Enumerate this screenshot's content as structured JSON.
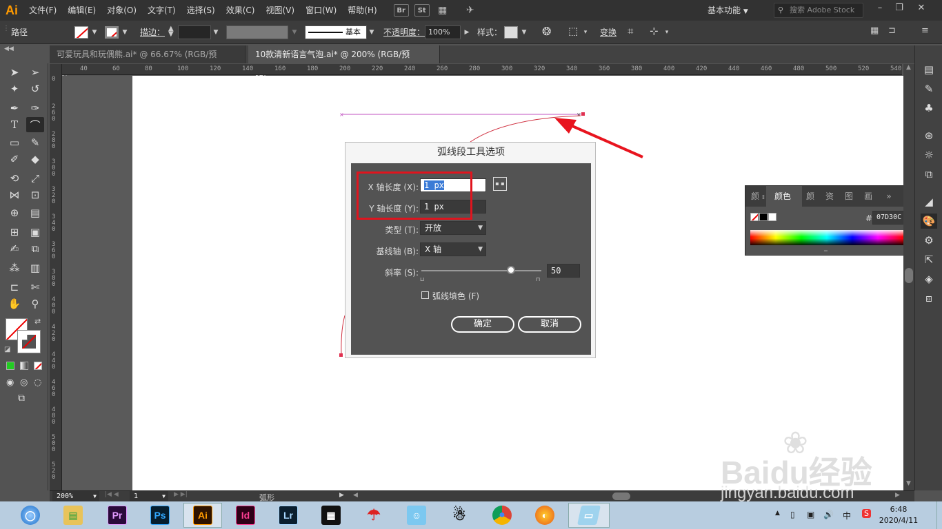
{
  "menubar": {
    "logo": "Ai",
    "items": [
      "文件(F)",
      "编辑(E)",
      "对象(O)",
      "文字(T)",
      "选择(S)",
      "效果(C)",
      "视图(V)",
      "窗口(W)",
      "帮助(H)"
    ],
    "bridge_label": "Br",
    "stock_label": "St",
    "workspace": "基本功能",
    "search_placeholder": "搜索 Adobe Stock",
    "accent_color": "#ff9a00"
  },
  "controlbar": {
    "selection_type": "路径",
    "stroke_label": "描边：",
    "stroke_profile": "基本",
    "opacity_label": "不透明度：",
    "opacity_value": "100%",
    "style_label": "样式：",
    "transform_label": "变换"
  },
  "tabs": [
    {
      "label": "可爱玩具和玩偶熊.ai* @ 66.67% (RGB/预览)",
      "close": "×",
      "active": false
    },
    {
      "label": "10款清新语言气泡.ai* @ 200% (RGB/预览)",
      "close": "×",
      "active": true
    }
  ],
  "ruler": {
    "h_ticks": [
      "40",
      "60",
      "80",
      "100",
      "120",
      "140",
      "160",
      "180",
      "200",
      "220",
      "240",
      "260",
      "280",
      "300",
      "320",
      "340",
      "360",
      "380",
      "400",
      "420",
      "440",
      "460",
      "480",
      "500",
      "520",
      "540"
    ],
    "v_ticks": [
      "0",
      "260",
      "280",
      "300",
      "320",
      "340",
      "360",
      "380",
      "400",
      "420",
      "440",
      "460",
      "480",
      "500",
      "520"
    ]
  },
  "dialog": {
    "title": "弧线段工具选项",
    "x_label": "X 轴长度 (X):",
    "x_value": "1 px",
    "y_label": "Y 轴长度 (Y):",
    "y_value": "1 px",
    "type_label": "类型 (T):",
    "type_value": "开放",
    "base_label": "基线轴 (B):",
    "base_value": "X 轴",
    "slope_label": "斜率 (S):",
    "slope_value": "50",
    "slope_level": 0.75,
    "fill_label": "弧线填色 (F)",
    "ok_label": "确定",
    "cancel_label": "取消"
  },
  "colorpanel": {
    "tabs": [
      "颜",
      "颜色",
      "颜",
      "资",
      "图",
      "画"
    ],
    "hex_prefix": "#",
    "hex_value": "07D30C",
    "more": "»"
  },
  "status": {
    "zoom": "200%",
    "page": "1",
    "tool_name": "弧形"
  },
  "taskbar": {
    "apps": [
      "Pr",
      "Ps",
      "Ai",
      "Id",
      "Lr"
    ],
    "ime": "中",
    "time": "6:48",
    "date": "2020/4/11"
  },
  "watermark": {
    "text": "Baidu经验",
    "url": "jingyan.baidu.com"
  }
}
